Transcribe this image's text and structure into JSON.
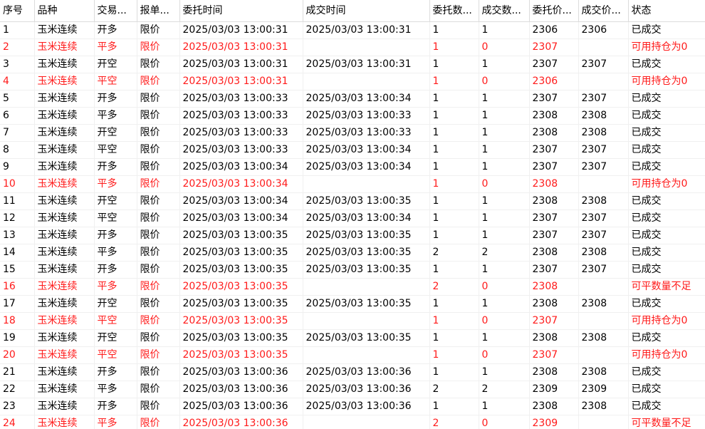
{
  "columns": [
    "序号",
    "品种",
    "交易...",
    "报单...",
    "委托时间",
    "成交时间",
    "委托数...",
    "成交数...",
    "委托价...",
    "成交价...",
    "状态"
  ],
  "colors": {
    "normal": "#000000",
    "error": "#ff1a1a"
  },
  "rows": [
    {
      "seq": "1",
      "product": "玉米连续",
      "trade": "开多",
      "order_type": "限价",
      "order_time": "2025/03/03 13:00:31",
      "fill_time": "2025/03/03 13:00:31",
      "order_qty": "1",
      "fill_qty": "1",
      "order_price": "2306",
      "fill_price": "2306",
      "status": "已成交",
      "error": false
    },
    {
      "seq": "2",
      "product": "玉米连续",
      "trade": "平多",
      "order_type": "限价",
      "order_time": "2025/03/03 13:00:31",
      "fill_time": "",
      "order_qty": "1",
      "fill_qty": "0",
      "order_price": "2307",
      "fill_price": "",
      "status": "可用持仓为0",
      "error": true
    },
    {
      "seq": "3",
      "product": "玉米连续",
      "trade": "开空",
      "order_type": "限价",
      "order_time": "2025/03/03 13:00:31",
      "fill_time": "2025/03/03 13:00:31",
      "order_qty": "1",
      "fill_qty": "1",
      "order_price": "2307",
      "fill_price": "2307",
      "status": "已成交",
      "error": false
    },
    {
      "seq": "4",
      "product": "玉米连续",
      "trade": "平空",
      "order_type": "限价",
      "order_time": "2025/03/03 13:00:31",
      "fill_time": "",
      "order_qty": "1",
      "fill_qty": "0",
      "order_price": "2306",
      "fill_price": "",
      "status": "可用持仓为0",
      "error": true
    },
    {
      "seq": "5",
      "product": "玉米连续",
      "trade": "开多",
      "order_type": "限价",
      "order_time": "2025/03/03 13:00:33",
      "fill_time": "2025/03/03 13:00:34",
      "order_qty": "1",
      "fill_qty": "1",
      "order_price": "2307",
      "fill_price": "2307",
      "status": "已成交",
      "error": false
    },
    {
      "seq": "6",
      "product": "玉米连续",
      "trade": "平多",
      "order_type": "限价",
      "order_time": "2025/03/03 13:00:33",
      "fill_time": "2025/03/03 13:00:33",
      "order_qty": "1",
      "fill_qty": "1",
      "order_price": "2308",
      "fill_price": "2308",
      "status": "已成交",
      "error": false
    },
    {
      "seq": "7",
      "product": "玉米连续",
      "trade": "开空",
      "order_type": "限价",
      "order_time": "2025/03/03 13:00:33",
      "fill_time": "2025/03/03 13:00:33",
      "order_qty": "1",
      "fill_qty": "1",
      "order_price": "2308",
      "fill_price": "2308",
      "status": "已成交",
      "error": false
    },
    {
      "seq": "8",
      "product": "玉米连续",
      "trade": "平空",
      "order_type": "限价",
      "order_time": "2025/03/03 13:00:33",
      "fill_time": "2025/03/03 13:00:34",
      "order_qty": "1",
      "fill_qty": "1",
      "order_price": "2307",
      "fill_price": "2307",
      "status": "已成交",
      "error": false
    },
    {
      "seq": "9",
      "product": "玉米连续",
      "trade": "开多",
      "order_type": "限价",
      "order_time": "2025/03/03 13:00:34",
      "fill_time": "2025/03/03 13:00:34",
      "order_qty": "1",
      "fill_qty": "1",
      "order_price": "2307",
      "fill_price": "2307",
      "status": "已成交",
      "error": false
    },
    {
      "seq": "10",
      "product": "玉米连续",
      "trade": "平多",
      "order_type": "限价",
      "order_time": "2025/03/03 13:00:34",
      "fill_time": "",
      "order_qty": "1",
      "fill_qty": "0",
      "order_price": "2308",
      "fill_price": "",
      "status": "可用持仓为0",
      "error": true
    },
    {
      "seq": "11",
      "product": "玉米连续",
      "trade": "开空",
      "order_type": "限价",
      "order_time": "2025/03/03 13:00:34",
      "fill_time": "2025/03/03 13:00:35",
      "order_qty": "1",
      "fill_qty": "1",
      "order_price": "2308",
      "fill_price": "2308",
      "status": "已成交",
      "error": false
    },
    {
      "seq": "12",
      "product": "玉米连续",
      "trade": "平空",
      "order_type": "限价",
      "order_time": "2025/03/03 13:00:34",
      "fill_time": "2025/03/03 13:00:34",
      "order_qty": "1",
      "fill_qty": "1",
      "order_price": "2307",
      "fill_price": "2307",
      "status": "已成交",
      "error": false
    },
    {
      "seq": "13",
      "product": "玉米连续",
      "trade": "开多",
      "order_type": "限价",
      "order_time": "2025/03/03 13:00:35",
      "fill_time": "2025/03/03 13:00:35",
      "order_qty": "1",
      "fill_qty": "1",
      "order_price": "2307",
      "fill_price": "2307",
      "status": "已成交",
      "error": false
    },
    {
      "seq": "14",
      "product": "玉米连续",
      "trade": "平多",
      "order_type": "限价",
      "order_time": "2025/03/03 13:00:35",
      "fill_time": "2025/03/03 13:00:35",
      "order_qty": "2",
      "fill_qty": "2",
      "order_price": "2308",
      "fill_price": "2308",
      "status": "已成交",
      "error": false
    },
    {
      "seq": "15",
      "product": "玉米连续",
      "trade": "开多",
      "order_type": "限价",
      "order_time": "2025/03/03 13:00:35",
      "fill_time": "2025/03/03 13:00:35",
      "order_qty": "1",
      "fill_qty": "1",
      "order_price": "2307",
      "fill_price": "2307",
      "status": "已成交",
      "error": false
    },
    {
      "seq": "16",
      "product": "玉米连续",
      "trade": "平多",
      "order_type": "限价",
      "order_time": "2025/03/03 13:00:35",
      "fill_time": "",
      "order_qty": "2",
      "fill_qty": "0",
      "order_price": "2308",
      "fill_price": "",
      "status": "可平数量不足",
      "error": true
    },
    {
      "seq": "17",
      "product": "玉米连续",
      "trade": "开空",
      "order_type": "限价",
      "order_time": "2025/03/03 13:00:35",
      "fill_time": "2025/03/03 13:00:35",
      "order_qty": "1",
      "fill_qty": "1",
      "order_price": "2308",
      "fill_price": "2308",
      "status": "已成交",
      "error": false
    },
    {
      "seq": "18",
      "product": "玉米连续",
      "trade": "平空",
      "order_type": "限价",
      "order_time": "2025/03/03 13:00:35",
      "fill_time": "",
      "order_qty": "1",
      "fill_qty": "0",
      "order_price": "2307",
      "fill_price": "",
      "status": "可用持仓为0",
      "error": true
    },
    {
      "seq": "19",
      "product": "玉米连续",
      "trade": "开空",
      "order_type": "限价",
      "order_time": "2025/03/03 13:00:35",
      "fill_time": "2025/03/03 13:00:35",
      "order_qty": "1",
      "fill_qty": "1",
      "order_price": "2308",
      "fill_price": "2308",
      "status": "已成交",
      "error": false
    },
    {
      "seq": "20",
      "product": "玉米连续",
      "trade": "平空",
      "order_type": "限价",
      "order_time": "2025/03/03 13:00:35",
      "fill_time": "",
      "order_qty": "1",
      "fill_qty": "0",
      "order_price": "2307",
      "fill_price": "",
      "status": "可用持仓为0",
      "error": true
    },
    {
      "seq": "21",
      "product": "玉米连续",
      "trade": "开多",
      "order_type": "限价",
      "order_time": "2025/03/03 13:00:36",
      "fill_time": "2025/03/03 13:00:36",
      "order_qty": "1",
      "fill_qty": "1",
      "order_price": "2308",
      "fill_price": "2308",
      "status": "已成交",
      "error": false
    },
    {
      "seq": "22",
      "product": "玉米连续",
      "trade": "平多",
      "order_type": "限价",
      "order_time": "2025/03/03 13:00:36",
      "fill_time": "2025/03/03 13:00:36",
      "order_qty": "2",
      "fill_qty": "2",
      "order_price": "2309",
      "fill_price": "2309",
      "status": "已成交",
      "error": false
    },
    {
      "seq": "23",
      "product": "玉米连续",
      "trade": "开多",
      "order_type": "限价",
      "order_time": "2025/03/03 13:00:36",
      "fill_time": "2025/03/03 13:00:36",
      "order_qty": "1",
      "fill_qty": "1",
      "order_price": "2308",
      "fill_price": "2308",
      "status": "已成交",
      "error": false
    },
    {
      "seq": "24",
      "product": "玉米连续",
      "trade": "平多",
      "order_type": "限价",
      "order_time": "2025/03/03 13:00:36",
      "fill_time": "",
      "order_qty": "2",
      "fill_qty": "0",
      "order_price": "2309",
      "fill_price": "",
      "status": "可平数量不足",
      "error": true
    }
  ]
}
